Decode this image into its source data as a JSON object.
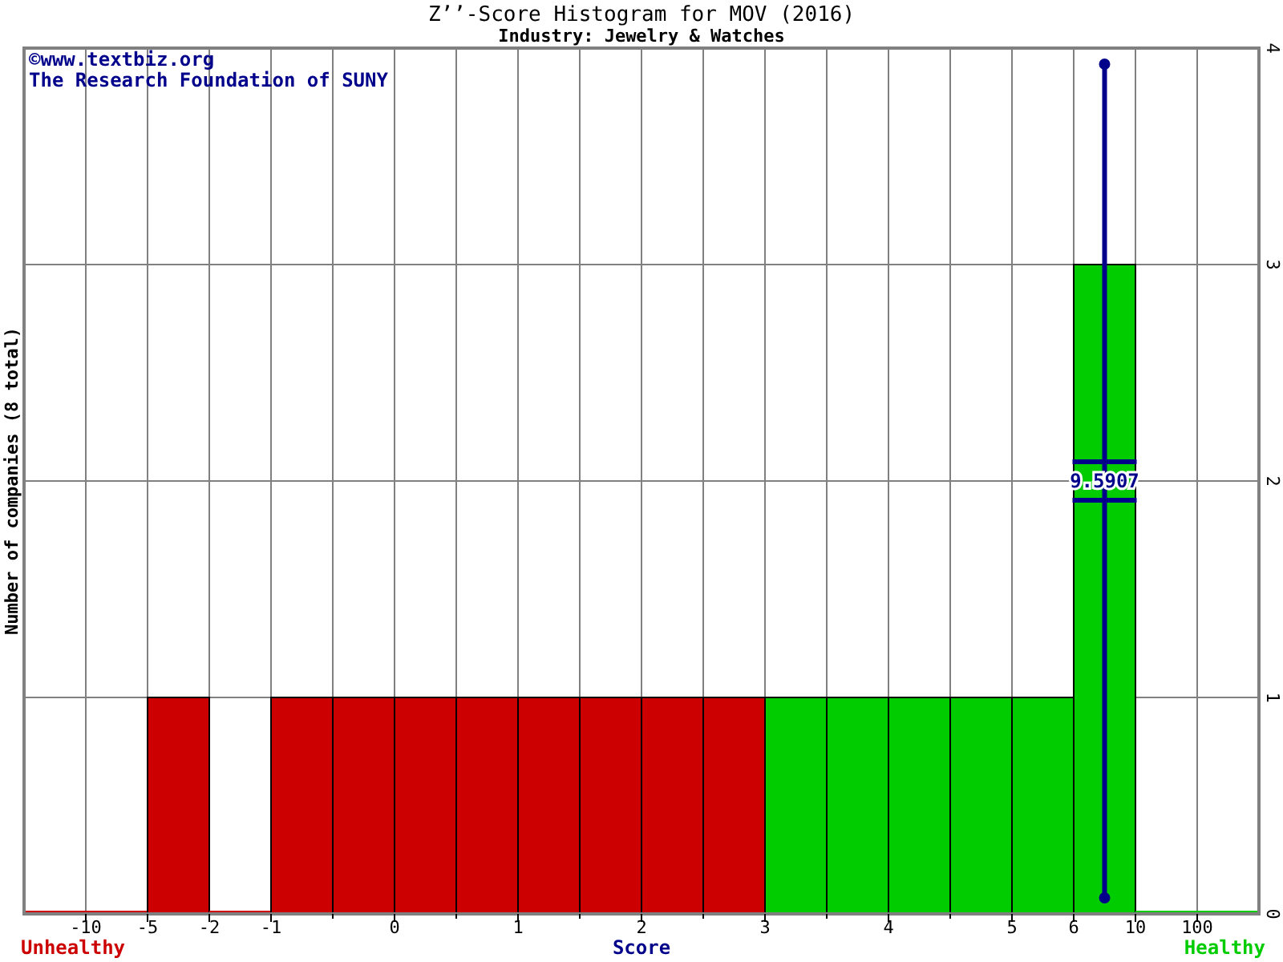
{
  "credit": [
    "©www.textbiz.org",
    "The Research Foundation of SUNY"
  ],
  "chart_data": {
    "type": "bar",
    "title": "Z’’-Score Histogram for MOV (2016)",
    "subtitle": "Industry: Jewelry & Watches",
    "xlabel": "Score",
    "ylabel": "Number of companies (8 total)",
    "categories": [
      null,
      null,
      null,
      null,
      null,
      null,
      null,
      null,
      null,
      null,
      null,
      null,
      null,
      null,
      null,
      null,
      null,
      null,
      null,
      null
    ],
    "series": [
      {
        "name": "Unhealthy",
        "color": "#cc0000",
        "values": [
          0,
          0,
          1,
          0,
          1,
          1,
          1,
          1,
          1,
          1,
          1,
          1,
          null,
          null,
          null,
          null,
          null,
          null,
          null,
          null
        ]
      },
      {
        "name": "Healthy",
        "color": "#00cc00",
        "values": [
          null,
          null,
          null,
          null,
          null,
          null,
          null,
          null,
          null,
          null,
          null,
          null,
          1,
          1,
          1,
          1,
          1,
          3,
          0,
          0
        ]
      }
    ],
    "grid": true,
    "legend": "bottom",
    "ylim": [
      0,
      4
    ],
    "yticks": [
      0,
      1,
      2,
      3,
      4
    ],
    "annotations": [
      "9.5907"
    ]
  },
  "x_axis_labels": [
    "-10",
    "-5",
    "-2",
    "-1",
    "0",
    "1",
    "2",
    "3",
    "4",
    "5",
    "6",
    "10",
    "100"
  ]
}
